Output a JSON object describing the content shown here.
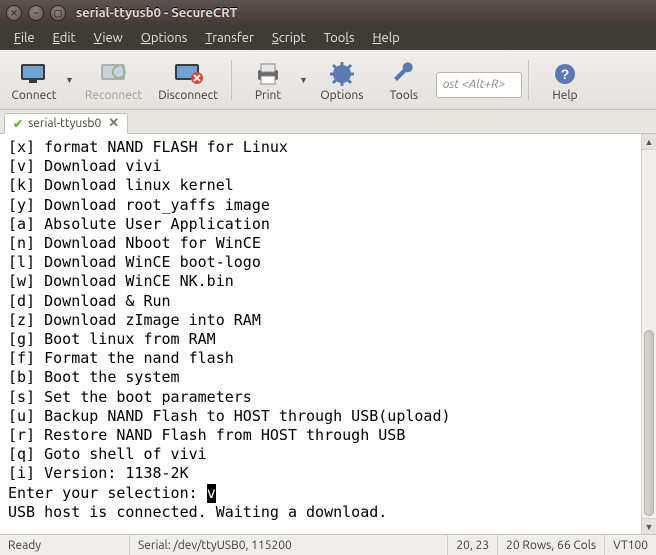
{
  "window": {
    "title": "serial-ttyusb0 - SecureCRT"
  },
  "menu": {
    "file": "File",
    "edit": "Edit",
    "view": "View",
    "options": "Options",
    "transfer": "Transfer",
    "script": "Script",
    "tools": "Tools",
    "help": "Help"
  },
  "toolbar": {
    "connect": "Connect",
    "reconnect": "Reconnect",
    "disconnect": "Disconnect",
    "print": "Print",
    "options": "Options",
    "tools": "Tools",
    "help": "Help",
    "host_placeholder": "ost <Alt+R>"
  },
  "tab": {
    "label": "serial-ttyusb0"
  },
  "terminal": {
    "lines": [
      "[x] format NAND FLASH for Linux",
      "[v] Download vivi",
      "[k] Download linux kernel",
      "[y] Download root_yaffs image",
      "[a] Absolute User Application",
      "[n] Download Nboot for WinCE",
      "[l] Download WinCE boot-logo",
      "[w] Download WinCE NK.bin",
      "[d] Download & Run",
      "[z] Download zImage into RAM",
      "[g] Boot linux from RAM",
      "[f] Format the nand flash",
      "[b] Boot the system",
      "[s] Set the boot parameters",
      "[u] Backup NAND Flash to HOST through USB(upload)",
      "[r] Restore NAND Flash from HOST through USB",
      "[q] Goto shell of vivi",
      "[i] Version: 1138-2K"
    ],
    "prompt": "Enter your selection: ",
    "cursor": "v",
    "tail": "USB host is connected. Waiting a download."
  },
  "status": {
    "ready": "Ready",
    "serial": "Serial: /dev/ttyUSB0, 115200",
    "pos": "20, 23",
    "size": "20 Rows, 66 Cols",
    "emu": "VT100"
  }
}
